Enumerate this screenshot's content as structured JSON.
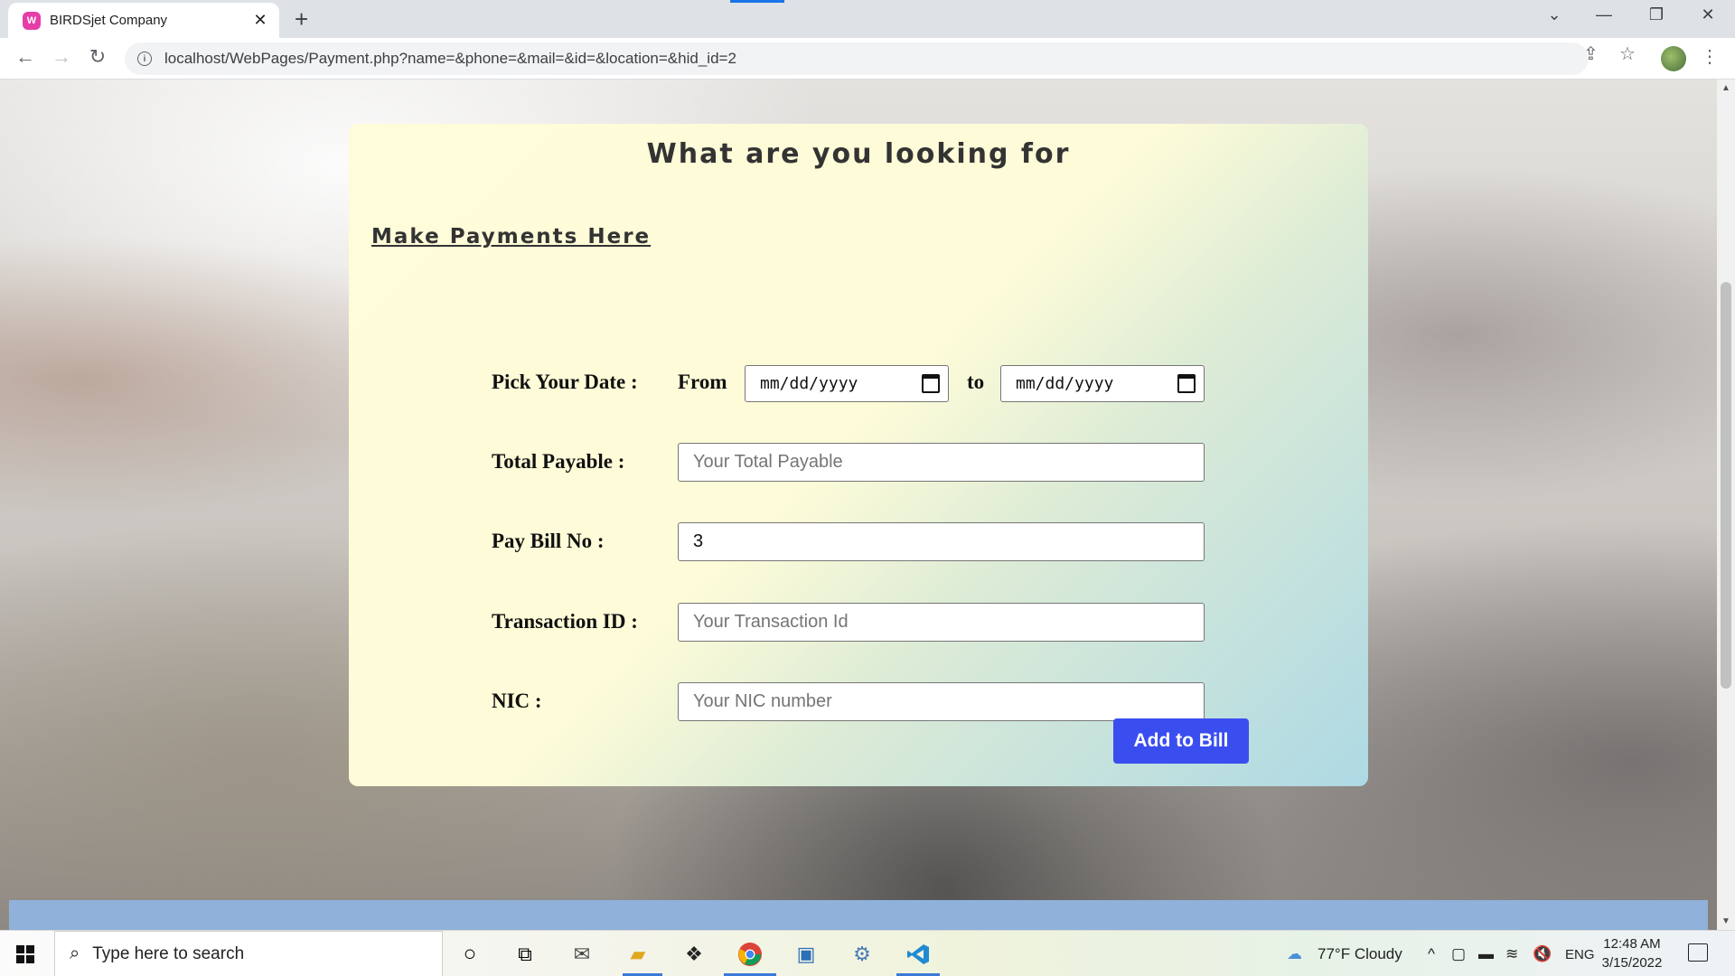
{
  "browser": {
    "tab_title": "BIRDSjet Company",
    "tab_favicon": "W",
    "tab_close": "✕",
    "new_tab": "+",
    "url": "localhost/WebPages/Payment.php?name=&phone=&mail=&id=&location=&hid_id=2",
    "window_controls": {
      "chevron": "⌄",
      "minimize": "—",
      "restore": "❐",
      "close": "✕"
    }
  },
  "page": {
    "heading": "What are you looking for",
    "section_title": "Make Payments Here",
    "form": {
      "date_label": "Pick Your Date :",
      "from_label": "From",
      "to_label": "to",
      "date_placeholder": "mm/dd/yyyy",
      "total_label": "Total Payable :",
      "total_placeholder": "Your Total Payable",
      "bill_label": "Pay Bill No :",
      "bill_value": "3",
      "txn_label": "Transaction ID :",
      "txn_placeholder": "Your Transaction Id",
      "nic_label": "NIC :",
      "nic_placeholder": "Your NIC number",
      "submit_label": "Add to Bill"
    },
    "colors": {
      "button": "#3a4ef0",
      "footer_band": "#8fb1da"
    }
  },
  "taskbar": {
    "search_placeholder": "Type here to search",
    "weather": "77°F  Cloudy",
    "language": "ENG",
    "time": "12:48 AM",
    "date": "3/15/2022",
    "icons": [
      "windows-start-icon",
      "cortana-icon",
      "task-view-icon",
      "mail-icon",
      "file-explorer-icon",
      "dropbox-icon",
      "chrome-icon",
      "app-icon",
      "settings-gear-icon",
      "vscode-icon"
    ]
  }
}
